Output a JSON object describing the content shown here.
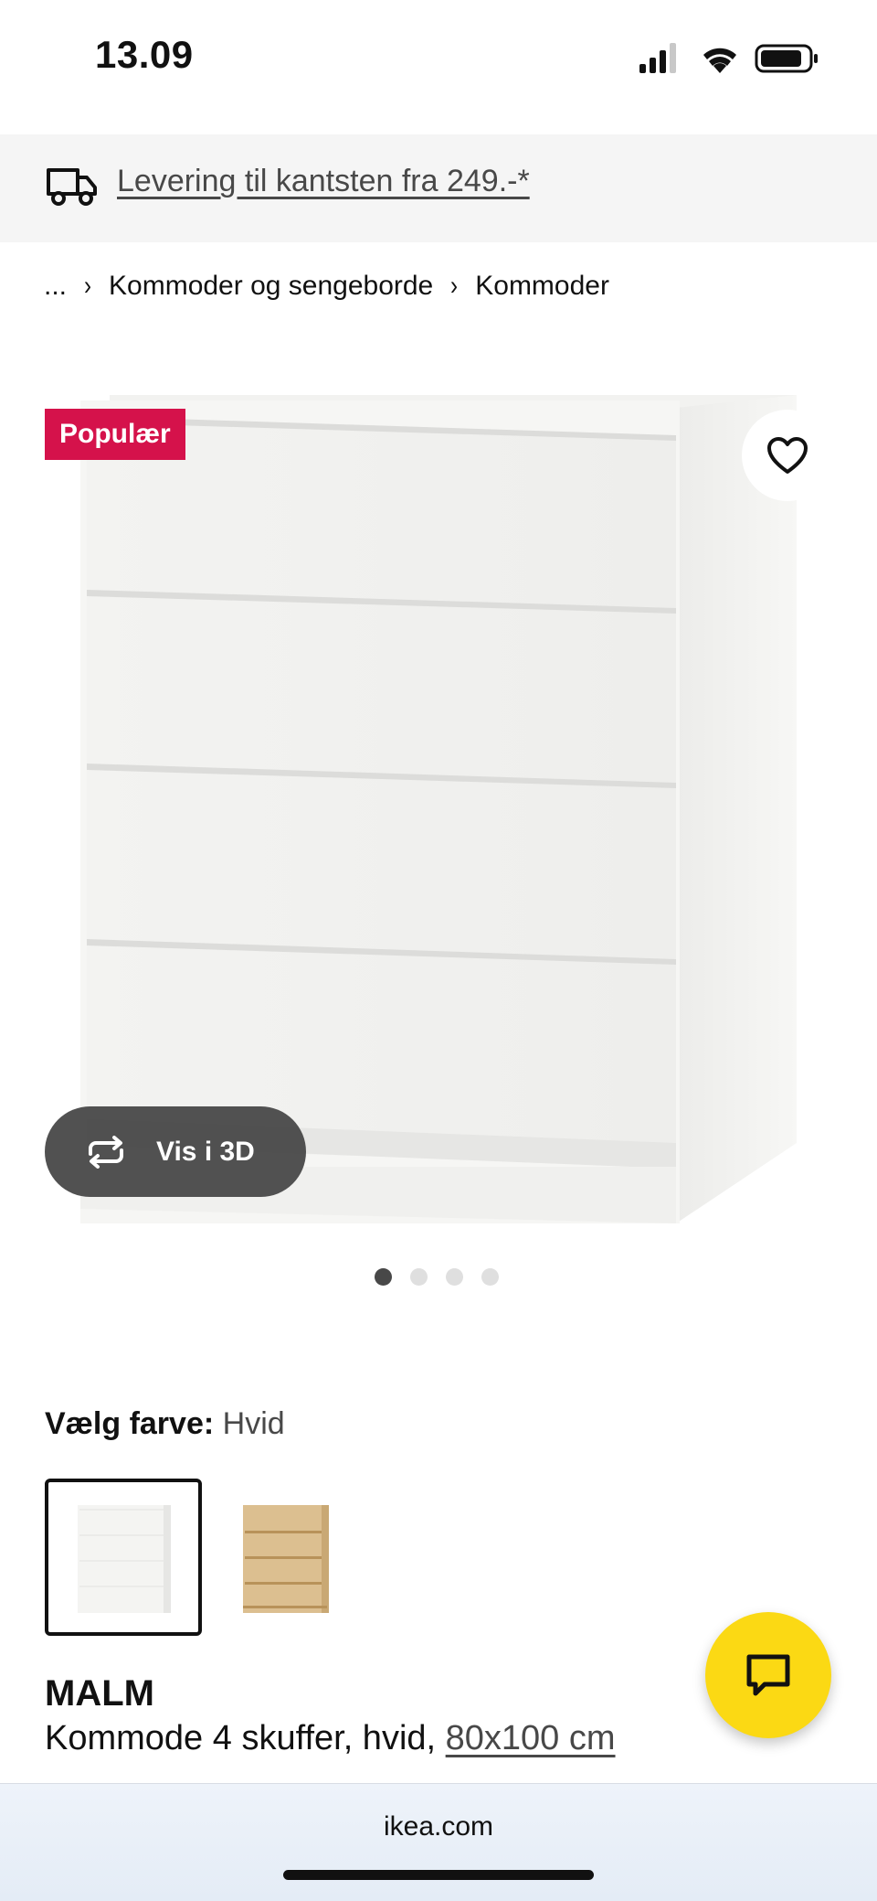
{
  "status_bar": {
    "time": "13.09"
  },
  "delivery_banner": {
    "text": "Levering til kantsten fra 249.-*"
  },
  "breadcrumb": {
    "ellipsis": "...",
    "items": [
      "Kommoder og sengeborde",
      "Kommoder"
    ]
  },
  "gallery": {
    "badge": "Populær",
    "view_3d_label": "Vis i 3D",
    "image_count": 4,
    "active_index": 0
  },
  "color_selector": {
    "label": "Vælg farve:",
    "value": "Hvid",
    "options": [
      {
        "name": "Hvid",
        "selected": true,
        "color": "#f4f4f2"
      },
      {
        "name": "Eg",
        "selected": false,
        "color": "#d9b98a"
      }
    ]
  },
  "product": {
    "name": "MALM",
    "description": "Kommode 4 skuffer, hvid, ",
    "size": "80x100 cm"
  },
  "browser": {
    "url": "ikea.com"
  },
  "colors": {
    "badge": "#d5124b",
    "chat_fab": "#fbd914",
    "dark_pill": "#484848"
  }
}
